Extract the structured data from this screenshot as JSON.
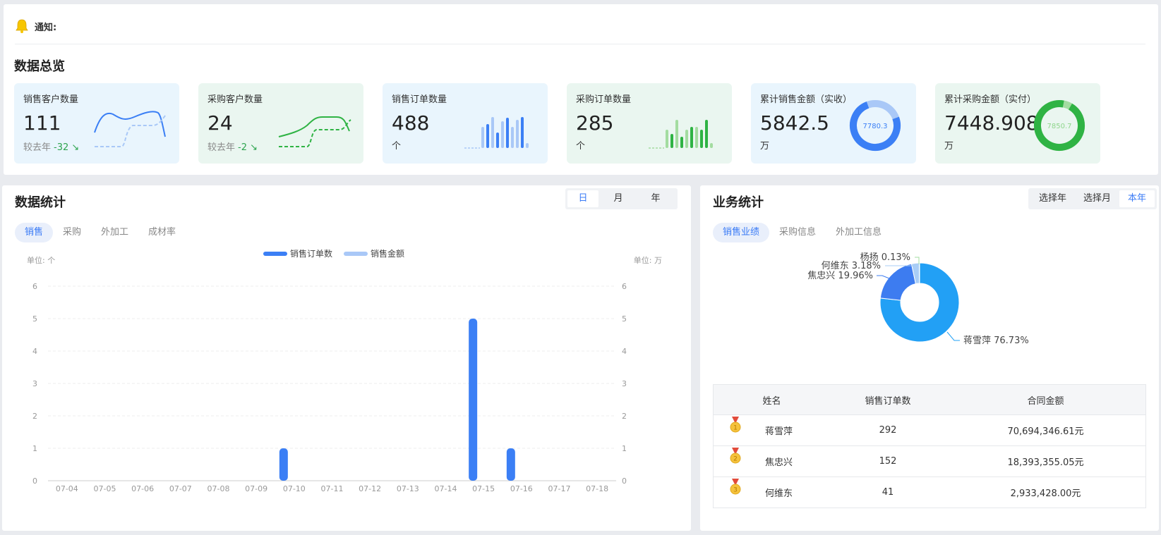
{
  "notice": {
    "label": "通知:"
  },
  "overview": {
    "title": "数据总览",
    "cards": [
      {
        "title": "销售客户数量",
        "value": "111",
        "sub_label": "较去年",
        "delta": "-32"
      },
      {
        "title": "采购客户数量",
        "value": "24",
        "sub_label": "较去年",
        "delta": "-2"
      },
      {
        "title": "销售订单数量",
        "value": "488",
        "unit": "个"
      },
      {
        "title": "采购订单数量",
        "value": "285",
        "unit": "个"
      },
      {
        "title": "累计销售金额（实收）",
        "value": "5842.5",
        "unit": "万",
        "ring_label": "7780.3"
      },
      {
        "title": "累计采购金额（实付）",
        "value": "7448.908",
        "unit": "万",
        "ring_label": "7850.7"
      }
    ]
  },
  "stats": {
    "title": "数据统计",
    "period_options": [
      "日",
      "月",
      "年"
    ],
    "period_active": "日",
    "tabs": [
      "销售",
      "采购",
      "外加工",
      "成材率"
    ],
    "tab_active": "销售",
    "unit_left": "单位: 个",
    "unit_right": "单位: 万"
  },
  "chart_data": {
    "type": "bar",
    "categories": [
      "07-04",
      "07-05",
      "07-06",
      "07-07",
      "07-08",
      "07-09",
      "07-10",
      "07-11",
      "07-12",
      "07-13",
      "07-14",
      "07-15",
      "07-16",
      "07-17",
      "07-18"
    ],
    "series": [
      {
        "name": "销售订单数",
        "color": "#3b7ff5",
        "values": [
          0,
          0,
          0,
          0,
          0,
          0,
          1,
          0,
          0,
          0,
          0,
          5,
          1,
          0,
          0
        ]
      },
      {
        "name": "销售金额",
        "color": "#a9c8f7",
        "values": [
          0,
          0,
          0,
          0,
          0,
          0,
          0,
          0,
          0,
          0,
          0,
          0,
          0,
          0,
          0
        ]
      }
    ],
    "ylim": [
      0,
      6
    ],
    "y_ticks": [
      0,
      1,
      2,
      3,
      4,
      5,
      6
    ],
    "y2_ticks": [
      0,
      1,
      2,
      3,
      4,
      5,
      6
    ],
    "legend": "top-center"
  },
  "biz": {
    "title": "业务统计",
    "period_options": [
      "选择年",
      "选择月",
      "本年"
    ],
    "period_active": "本年",
    "tabs": [
      "销售业绩",
      "采购信息",
      "外加工信息"
    ],
    "tab_active": "销售业绩",
    "pie": [
      {
        "name": "蒋雪萍",
        "pct": 76.73,
        "label": "蒋雪萍 76.73%",
        "color": "#22a0f5"
      },
      {
        "name": "焦忠兴",
        "pct": 19.96,
        "label": "焦忠兴 19.96%",
        "color": "#3d7cf0"
      },
      {
        "name": "何维东",
        "pct": 3.18,
        "label": "何维东 3.18%",
        "color": "#a8cdf6"
      },
      {
        "name": "杨扬",
        "pct": 0.13,
        "label": "杨扬 0.13%",
        "color": "#a3dca0"
      }
    ],
    "table": {
      "headers": [
        "姓名",
        "销售订单数",
        "合同金额"
      ],
      "rows": [
        {
          "rank": "1",
          "name": "蒋雪萍",
          "orders": "292",
          "amount": "70,694,346.61元"
        },
        {
          "rank": "2",
          "name": "焦忠兴",
          "orders": "152",
          "amount": "18,393,355.05元"
        },
        {
          "rank": "3",
          "name": "何维东",
          "orders": "41",
          "amount": "2,933,428.00元"
        }
      ]
    }
  }
}
